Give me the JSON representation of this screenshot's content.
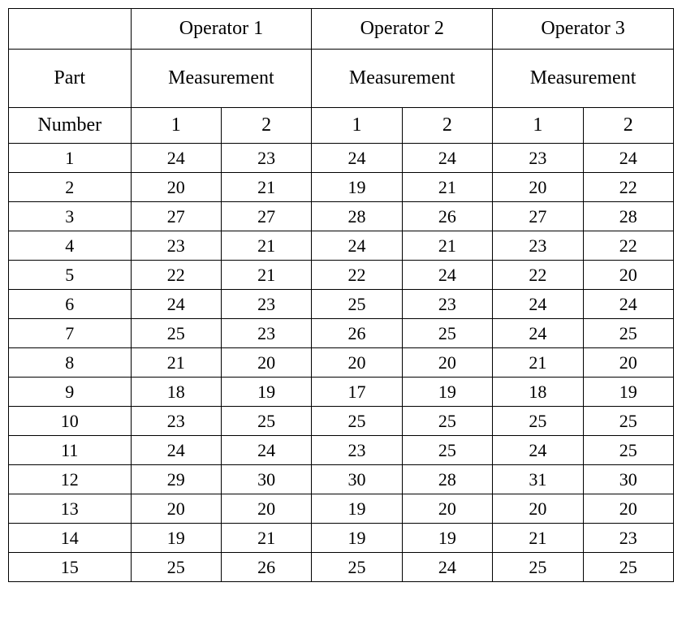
{
  "chart_data": {
    "type": "table",
    "title": "",
    "header_top_blank": "",
    "operators": [
      "Operator 1",
      "Operator 2",
      "Operator 3"
    ],
    "part_label": "Part",
    "measurement_label": "Measurement",
    "number_label": "Number",
    "replicate_labels": [
      "1",
      "2"
    ],
    "parts": [
      {
        "number": "1",
        "op1": [
          24,
          23
        ],
        "op2": [
          24,
          24
        ],
        "op3": [
          23,
          24
        ]
      },
      {
        "number": "2",
        "op1": [
          20,
          21
        ],
        "op2": [
          19,
          21
        ],
        "op3": [
          20,
          22
        ]
      },
      {
        "number": "3",
        "op1": [
          27,
          27
        ],
        "op2": [
          28,
          26
        ],
        "op3": [
          27,
          28
        ]
      },
      {
        "number": "4",
        "op1": [
          23,
          21
        ],
        "op2": [
          24,
          21
        ],
        "op3": [
          23,
          22
        ]
      },
      {
        "number": "5",
        "op1": [
          22,
          21
        ],
        "op2": [
          22,
          24
        ],
        "op3": [
          22,
          20
        ]
      },
      {
        "number": "6",
        "op1": [
          24,
          23
        ],
        "op2": [
          25,
          23
        ],
        "op3": [
          24,
          24
        ]
      },
      {
        "number": "7",
        "op1": [
          25,
          23
        ],
        "op2": [
          26,
          25
        ],
        "op3": [
          24,
          25
        ]
      },
      {
        "number": "8",
        "op1": [
          21,
          20
        ],
        "op2": [
          20,
          20
        ],
        "op3": [
          21,
          20
        ]
      },
      {
        "number": "9",
        "op1": [
          18,
          19
        ],
        "op2": [
          17,
          19
        ],
        "op3": [
          18,
          19
        ]
      },
      {
        "number": "10",
        "op1": [
          23,
          25
        ],
        "op2": [
          25,
          25
        ],
        "op3": [
          25,
          25
        ]
      },
      {
        "number": "11",
        "op1": [
          24,
          24
        ],
        "op2": [
          23,
          25
        ],
        "op3": [
          24,
          25
        ]
      },
      {
        "number": "12",
        "op1": [
          29,
          30
        ],
        "op2": [
          30,
          28
        ],
        "op3": [
          31,
          30
        ]
      },
      {
        "number": "13",
        "op1": [
          20,
          20
        ],
        "op2": [
          19,
          20
        ],
        "op3": [
          20,
          20
        ]
      },
      {
        "number": "14",
        "op1": [
          19,
          21
        ],
        "op2": [
          19,
          19
        ],
        "op3": [
          21,
          23
        ]
      },
      {
        "number": "15",
        "op1": [
          25,
          26
        ],
        "op2": [
          25,
          24
        ],
        "op3": [
          25,
          25
        ]
      }
    ]
  }
}
